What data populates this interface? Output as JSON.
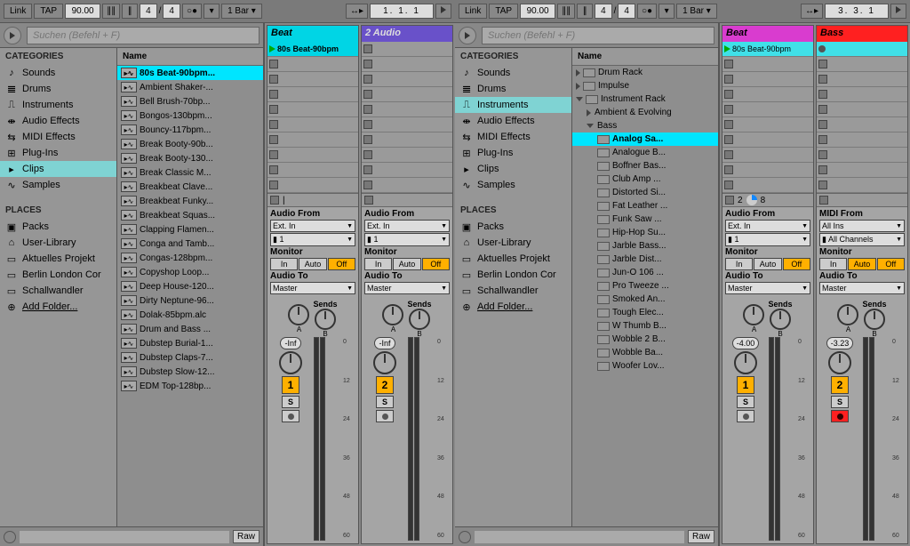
{
  "topbar": {
    "link": "Link",
    "tap": "TAP",
    "tempo": "90.00",
    "sig1": "4",
    "sig2": "4",
    "quant": "1 Bar",
    "pos_left": "1.  1.  1",
    "pos_right": "3.  3.  1"
  },
  "browser": {
    "search_placeholder": "Suchen (Befehl + F)",
    "categories_header": "CATEGORIES",
    "places_header": "PLACES",
    "name_header": "Name",
    "raw": "Raw",
    "categories": [
      {
        "icon": "♪",
        "label": "Sounds"
      },
      {
        "icon": "𝌆",
        "label": "Drums"
      },
      {
        "icon": "⎍",
        "label": "Instruments"
      },
      {
        "icon": "⇼",
        "label": "Audio Effects"
      },
      {
        "icon": "⇆",
        "label": "MIDI Effects"
      },
      {
        "icon": "⊞",
        "label": "Plug-Ins"
      },
      {
        "icon": "▸",
        "label": "Clips"
      },
      {
        "icon": "∿",
        "label": "Samples"
      }
    ],
    "places": [
      {
        "icon": "▣",
        "label": "Packs"
      },
      {
        "icon": "⌂",
        "label": "User-Library"
      },
      {
        "icon": "▭",
        "label": "Aktuelles Projekt"
      },
      {
        "icon": "▭",
        "label": "Berlin London Cor"
      },
      {
        "icon": "▭",
        "label": "Schallwandler"
      },
      {
        "icon": "⊕",
        "label": "Add Folder..."
      }
    ],
    "clips": [
      "80s Beat-90bpm...",
      "Ambient Shaker-...",
      "Bell Brush-70bp...",
      "Bongos-130bpm...",
      "Bouncy-117bpm...",
      "Break Booty-90b...",
      "Break Booty-130...",
      "Break Classic M...",
      "Breakbeat Clave...",
      "Breakbeat Funky...",
      "Breakbeat Squas...",
      "Clapping Flamen...",
      "Conga and Tamb...",
      "Congas-128bpm...",
      "Copyshop Loop...",
      "Deep House-120...",
      "Dirty Neptune-96...",
      "Dolak-85bpm.alc",
      "Drum and Bass ...",
      "Dubstep Burial-1...",
      "Dubstep Claps-7...",
      "Dubstep Slow-12...",
      "EDM Top-128bp..."
    ],
    "instruments_tree": {
      "top": [
        "Drum Rack",
        "Impulse",
        "Instrument Rack"
      ],
      "sub": [
        "Ambient & Evolving",
        "Bass"
      ],
      "selected": "Analog Sa...",
      "bass": [
        "Analogue B...",
        "Boffner Bas...",
        "Club Amp ...",
        "Distorted Si...",
        "Fat Leather ...",
        "Funk Saw ...",
        "Hip-Hop Su...",
        "Jarble Bass...",
        "Jarble Dist...",
        "Jun-O 106 ...",
        "Pro Tweeze ...",
        "Smoked An...",
        "Tough Elec...",
        "W Thumb B...",
        "Wobble 2 B...",
        "Wobble Ba...",
        "Woofer Lov..."
      ]
    }
  },
  "tracks": {
    "beat": "Beat",
    "audio2": "2 Audio",
    "bass": "Bass",
    "clip1": "80s Beat-90bpm",
    "audio_from": "Audio From",
    "midi_from": "MIDI From",
    "ext_in": "Ext. In",
    "all_ins": "All Ins",
    "all_channels": "All Channels",
    "ch1": "1",
    "monitor": "Monitor",
    "mon_in": "In",
    "mon_auto": "Auto",
    "mon_off": "Off",
    "audio_to": "Audio To",
    "master": "Master",
    "sends": "Sends",
    "vol_inf": "-Inf",
    "vol_4": "-4.00",
    "vol_323": "-3.23",
    "n1": "1",
    "n2": "2",
    "n8": "8",
    "s": "S",
    "scale": [
      "0",
      "12",
      "24",
      "36",
      "48",
      "60"
    ]
  }
}
